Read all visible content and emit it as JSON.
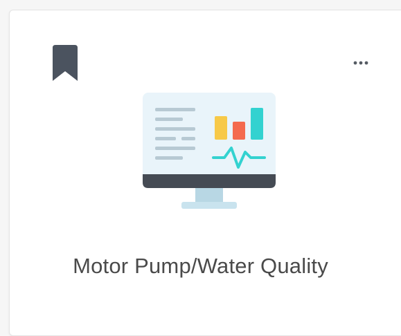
{
  "card": {
    "title": "Motor Pump/Water Quality",
    "bookmark_icon": "bookmark-icon",
    "more_icon": "more-horizontal-icon",
    "illustration_icon": "monitor-dashboard-icon"
  },
  "colors": {
    "bookmark": "#4b535f",
    "title_text": "#4a4a4a",
    "screen_bg": "#e9f4fa",
    "monitor_dark": "#454b54",
    "bar_yellow": "#f7c948",
    "bar_red": "#f46a4e",
    "bar_teal": "#33d2d0",
    "stand": "#c9e3ee"
  }
}
